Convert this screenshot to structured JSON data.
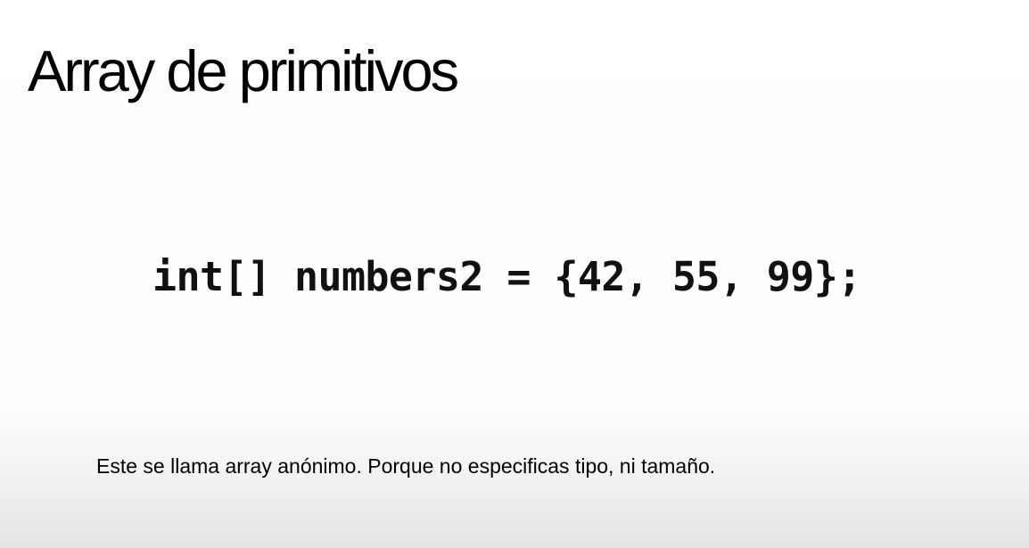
{
  "slide": {
    "title": "Array de primitivos",
    "code": "int[] numbers2 = {42, 55, 99};"
  },
  "caption": "Este se llama array anónimo. Porque no especificas tipo, ni tamaño."
}
